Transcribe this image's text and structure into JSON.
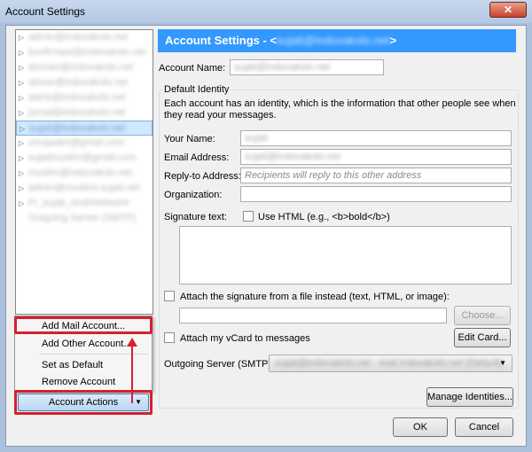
{
  "window": {
    "title": "Account Settings",
    "close_glyph": "✕"
  },
  "tree": {
    "items": [
      {
        "label": "admin@indovakolo.net",
        "arrow": "▷",
        "selected": false
      },
      {
        "label": "konfirmasi@indovakolo.net",
        "arrow": "▷",
        "selected": false
      },
      {
        "label": "domain@indovakolo.net",
        "arrow": "▷",
        "selected": false
      },
      {
        "label": "abuse@indovakolo.net",
        "arrow": "▷",
        "selected": false
      },
      {
        "label": "alerts@indovakolo.net",
        "arrow": "▷",
        "selected": false
      },
      {
        "label": "jurnal@indovakolo.net",
        "arrow": "▷",
        "selected": false
      },
      {
        "label": "sujati@indovakolo.net",
        "arrow": "▷",
        "selected": true
      },
      {
        "label": "sinujaatm@gmail.com",
        "arrow": "▷",
        "selected": false
      },
      {
        "label": "sujatimuslim@gmail.com",
        "arrow": "▷",
        "selected": false
      },
      {
        "label": "muslim@indovakolo.net",
        "arrow": "▷",
        "selected": false
      },
      {
        "label": "admin@muslimi.sujati.net",
        "arrow": "▷",
        "selected": false
      },
      {
        "label": "FI_sujati_AndriNetwork",
        "arrow": "▷",
        "selected": false
      },
      {
        "label": "Outgoing Server (SMTP)",
        "arrow": "",
        "selected": false
      }
    ]
  },
  "menu": {
    "items": [
      {
        "label": "Add Mail Account...",
        "highlighted": true
      },
      {
        "label": "Add Other Account...",
        "highlighted": false
      },
      {
        "label": "Set as Default",
        "highlighted": false
      },
      {
        "label": "Remove Account",
        "highlighted": false
      }
    ]
  },
  "actions_button": {
    "label": "Account Actions",
    "dropdown_glyph": "▼"
  },
  "header": {
    "prefix": "Account Settings - <",
    "email": "sujati@indovakolo.net",
    "suffix": ">"
  },
  "account_name": {
    "label": "Account Name:",
    "value": "sujati@indovakolo.net"
  },
  "identity": {
    "group_title": "Default Identity",
    "description": "Each account has an identity, which is the information that other people see when they read your messages.",
    "your_name": {
      "label": "Your Name:",
      "value": "sujati"
    },
    "email": {
      "label": "Email Address:",
      "value": "sujati@indovakolo.net"
    },
    "reply_to": {
      "label": "Reply-to Address:",
      "placeholder": "Recipients will reply to this other address"
    },
    "organization": {
      "label": "Organization:",
      "value": ""
    },
    "signature": {
      "label": "Signature text:",
      "use_html_label": "Use HTML (e.g., <b>bold</b>)"
    },
    "attach_sig_label": "Attach the signature from a file instead (text, HTML, or image):",
    "choose_button": "Choose...",
    "vcard_label": "Attach my vCard to messages",
    "edit_card_button": "Edit Card...",
    "smtp_label": "Outgoing Server (SMTP):",
    "smtp_value": "sujati@indovakolo.net - mail.indovakolo.net (Default)"
  },
  "buttons": {
    "manage_identities": "Manage Identities...",
    "ok": "OK",
    "cancel": "Cancel"
  },
  "colors": {
    "header_bg": "#3399ff",
    "highlight_red": "#d6202c",
    "selection": "#cde8ff"
  }
}
